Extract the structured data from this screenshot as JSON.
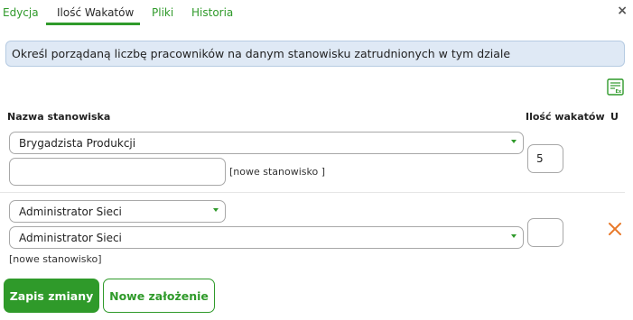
{
  "tabs": [
    {
      "label": "Edycja",
      "active": false
    },
    {
      "label": "Ilość Wakatów",
      "active": true
    },
    {
      "label": "Pliki",
      "active": false
    },
    {
      "label": "Historia",
      "active": false
    }
  ],
  "close_label": "×",
  "info": "Określ porządaną liczbę pracowników na danym stanowisku zatrudnionych w tym dziale",
  "columns": {
    "position": "Nazwa stanowiska",
    "vacancies": "Ilość wakatów",
    "u": "U"
  },
  "rows": [
    {
      "position_select": "Brygadzista Produkcji",
      "new_position_value": "",
      "new_position_hint": "[nowe stanowisko ]",
      "quantity": "5"
    },
    {
      "category_select": "Administrator Sieci",
      "position_select": "Administrator Sieci",
      "new_position_hint": "[nowe stanowisko]",
      "quantity": ""
    }
  ],
  "buttons": {
    "save": "Zapis zmiany",
    "new_assumption": "Nowe założenie"
  },
  "colors": {
    "accent": "#2f9a2a",
    "delete": "#e8792a",
    "info_bg": "#dfe9f5"
  },
  "icons": [
    "excel-export-icon",
    "close-icon",
    "delete-icon",
    "chevron-down-icon"
  ]
}
